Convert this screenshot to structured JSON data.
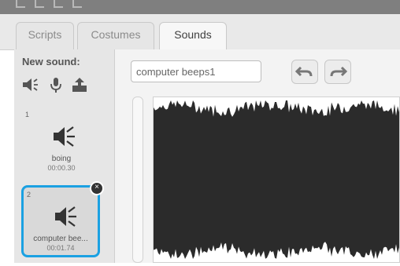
{
  "tabs": [
    {
      "label": "Scripts"
    },
    {
      "label": "Costumes"
    },
    {
      "label": "Sounds"
    }
  ],
  "sidebar": {
    "heading": "New sound:",
    "tools": [
      {
        "icon": "speaker-library-icon"
      },
      {
        "icon": "microphone-icon"
      },
      {
        "icon": "upload-icon"
      }
    ],
    "sounds": [
      {
        "index": "1",
        "name": "boing",
        "duration": "00:00.30",
        "icon": "speaker-icon"
      },
      {
        "index": "2",
        "name": "computer bee...",
        "duration": "00:01.74",
        "icon": "speaker-icon",
        "selected": true
      }
    ]
  },
  "editor": {
    "sound_name": "computer beeps1",
    "undo_icon": "undo-icon",
    "redo_icon": "redo-icon"
  },
  "colors": {
    "accent": "#1ba1e2",
    "waveform": "#2b2b2b"
  }
}
